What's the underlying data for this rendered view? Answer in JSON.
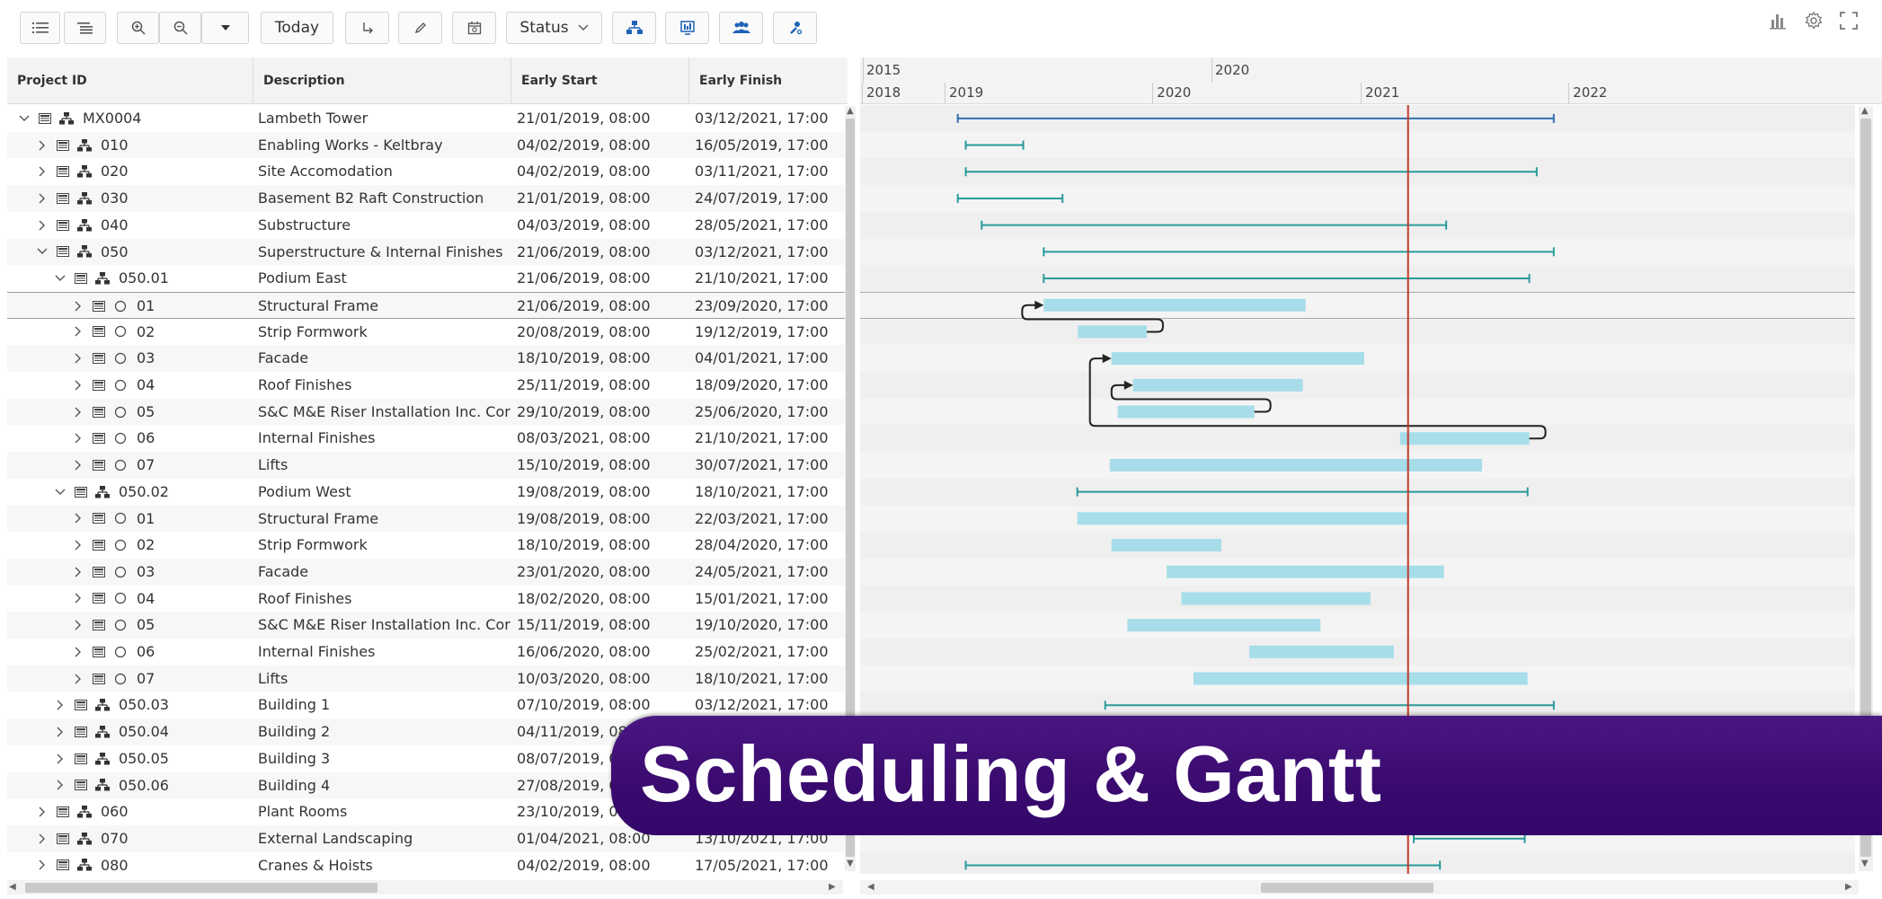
{
  "toolbar": {
    "today_label": "Today",
    "status_label": "Status"
  },
  "grid": {
    "columns": [
      "Project ID",
      "Description",
      "Early Start",
      "Early Finish"
    ],
    "rows": [
      {
        "id": "MX0004",
        "desc": "Lambeth Tower",
        "start": "21/01/2019, 08:00",
        "finish": "03/12/2021, 17:00",
        "level": 0,
        "type": "wbs",
        "expanded": true
      },
      {
        "id": "010",
        "desc": "Enabling Works - Keltbray",
        "start": "04/02/2019, 08:00",
        "finish": "16/05/2019, 17:00",
        "level": 1,
        "type": "wbs",
        "expanded": false
      },
      {
        "id": "020",
        "desc": "Site Accomodation",
        "start": "04/02/2019, 08:00",
        "finish": "03/11/2021, 17:00",
        "level": 1,
        "type": "wbs",
        "expanded": false
      },
      {
        "id": "030",
        "desc": "Basement B2 Raft Construction",
        "start": "21/01/2019, 08:00",
        "finish": "24/07/2019, 17:00",
        "level": 1,
        "type": "wbs",
        "expanded": false
      },
      {
        "id": "040",
        "desc": "Substructure",
        "start": "04/03/2019, 08:00",
        "finish": "28/05/2021, 17:00",
        "level": 1,
        "type": "wbs",
        "expanded": false
      },
      {
        "id": "050",
        "desc": "Superstructure & Internal Finishes",
        "start": "21/06/2019, 08:00",
        "finish": "03/12/2021, 17:00",
        "level": 1,
        "type": "wbs",
        "expanded": true
      },
      {
        "id": "050.01",
        "desc": "Podium East",
        "start": "21/06/2019, 08:00",
        "finish": "21/10/2021, 17:00",
        "level": 2,
        "type": "wbs",
        "expanded": true
      },
      {
        "id": "01",
        "desc": "Structural Frame",
        "start": "21/06/2019, 08:00",
        "finish": "23/09/2020, 17:00",
        "level": 3,
        "type": "task",
        "expanded": false
      },
      {
        "id": "02",
        "desc": "Strip Formwork",
        "start": "20/08/2019, 08:00",
        "finish": "19/12/2019, 17:00",
        "level": 3,
        "type": "task",
        "expanded": false
      },
      {
        "id": "03",
        "desc": "Facade",
        "start": "18/10/2019, 08:00",
        "finish": "04/01/2021, 17:00",
        "level": 3,
        "type": "task",
        "expanded": false
      },
      {
        "id": "04",
        "desc": "Roof Finishes",
        "start": "25/11/2019, 08:00",
        "finish": "18/09/2020, 17:00",
        "level": 3,
        "type": "task",
        "expanded": false
      },
      {
        "id": "05",
        "desc": "S&C M&E Riser Installation Inc. Corr...",
        "start": "29/10/2019, 08:00",
        "finish": "25/06/2020, 17:00",
        "level": 3,
        "type": "task",
        "expanded": false
      },
      {
        "id": "06",
        "desc": "Internal Finishes",
        "start": "08/03/2021, 08:00",
        "finish": "21/10/2021, 17:00",
        "level": 3,
        "type": "task",
        "expanded": false
      },
      {
        "id": "07",
        "desc": "Lifts",
        "start": "15/10/2019, 08:00",
        "finish": "30/07/2021, 17:00",
        "level": 3,
        "type": "task",
        "expanded": false
      },
      {
        "id": "050.02",
        "desc": "Podium West",
        "start": "19/08/2019, 08:00",
        "finish": "18/10/2021, 17:00",
        "level": 2,
        "type": "wbs",
        "expanded": true
      },
      {
        "id": "01",
        "desc": "Structural Frame",
        "start": "19/08/2019, 08:00",
        "finish": "22/03/2021, 17:00",
        "level": 3,
        "type": "task",
        "expanded": false
      },
      {
        "id": "02",
        "desc": "Strip Formwork",
        "start": "18/10/2019, 08:00",
        "finish": "28/04/2020, 17:00",
        "level": 3,
        "type": "task",
        "expanded": false
      },
      {
        "id": "03",
        "desc": "Facade",
        "start": "23/01/2020, 08:00",
        "finish": "24/05/2021, 17:00",
        "level": 3,
        "type": "task",
        "expanded": false
      },
      {
        "id": "04",
        "desc": "Roof Finishes",
        "start": "18/02/2020, 08:00",
        "finish": "15/01/2021, 17:00",
        "level": 3,
        "type": "task",
        "expanded": false
      },
      {
        "id": "05",
        "desc": "S&C M&E Riser Installation Inc. Corr...",
        "start": "15/11/2019, 08:00",
        "finish": "19/10/2020, 17:00",
        "level": 3,
        "type": "task",
        "expanded": false
      },
      {
        "id": "06",
        "desc": "Internal Finishes",
        "start": "16/06/2020, 08:00",
        "finish": "25/02/2021, 17:00",
        "level": 3,
        "type": "task",
        "expanded": false
      },
      {
        "id": "07",
        "desc": "Lifts",
        "start": "10/03/2020, 08:00",
        "finish": "18/10/2021, 17:00",
        "level": 3,
        "type": "task",
        "expanded": false
      },
      {
        "id": "050.03",
        "desc": "Building 1",
        "start": "07/10/2019, 08:00",
        "finish": "03/12/2021, 17:00",
        "level": 2,
        "type": "wbs",
        "expanded": false
      },
      {
        "id": "050.04",
        "desc": "Building 2",
        "start": "04/11/2019, 08:00",
        "finish": "",
        "level": 2,
        "type": "wbs",
        "expanded": false
      },
      {
        "id": "050.05",
        "desc": "Building 3",
        "start": "08/07/2019, 08:00",
        "finish": "",
        "level": 2,
        "type": "wbs",
        "expanded": false
      },
      {
        "id": "050.06",
        "desc": "Building 4",
        "start": "27/08/2019, 0",
        "finish": "",
        "level": 2,
        "type": "wbs",
        "expanded": false
      },
      {
        "id": "060",
        "desc": "Plant Rooms",
        "start": "23/10/2019, 08",
        "finish": "",
        "level": 1,
        "type": "wbs",
        "expanded": false
      },
      {
        "id": "070",
        "desc": "External Landscaping",
        "start": "01/04/2021, 08:00",
        "finish": "13/10/2021, 17:00",
        "level": 1,
        "type": "wbs",
        "expanded": false
      },
      {
        "id": "080",
        "desc": "Cranes & Hoists",
        "start": "04/02/2019, 08:00",
        "finish": "17/05/2021, 17:00",
        "level": 1,
        "type": "wbs",
        "expanded": false
      }
    ]
  },
  "timeline": {
    "major": [
      {
        "label": "2015",
        "date": "2015-01-01"
      },
      {
        "label": "2020",
        "date": "2020-01-01"
      }
    ],
    "minor": [
      {
        "label": "2018",
        "date": "2018-01-01"
      },
      {
        "label": "2019",
        "date": "2019-01-01"
      },
      {
        "label": "2020",
        "date": "2020-01-01"
      },
      {
        "label": "2021",
        "date": "2021-01-01"
      },
      {
        "label": "2022",
        "date": "2022-01-01"
      }
    ],
    "today": "2021-03-22"
  },
  "colors": {
    "summary_blue": "#2f6fb0",
    "summary_teal": "#2a9a9a",
    "task_bar": "#a6dde9",
    "today_line": "#c0392b",
    "banner": "#3a0a6e"
  },
  "banner": {
    "title": "Scheduling & Gantt"
  }
}
